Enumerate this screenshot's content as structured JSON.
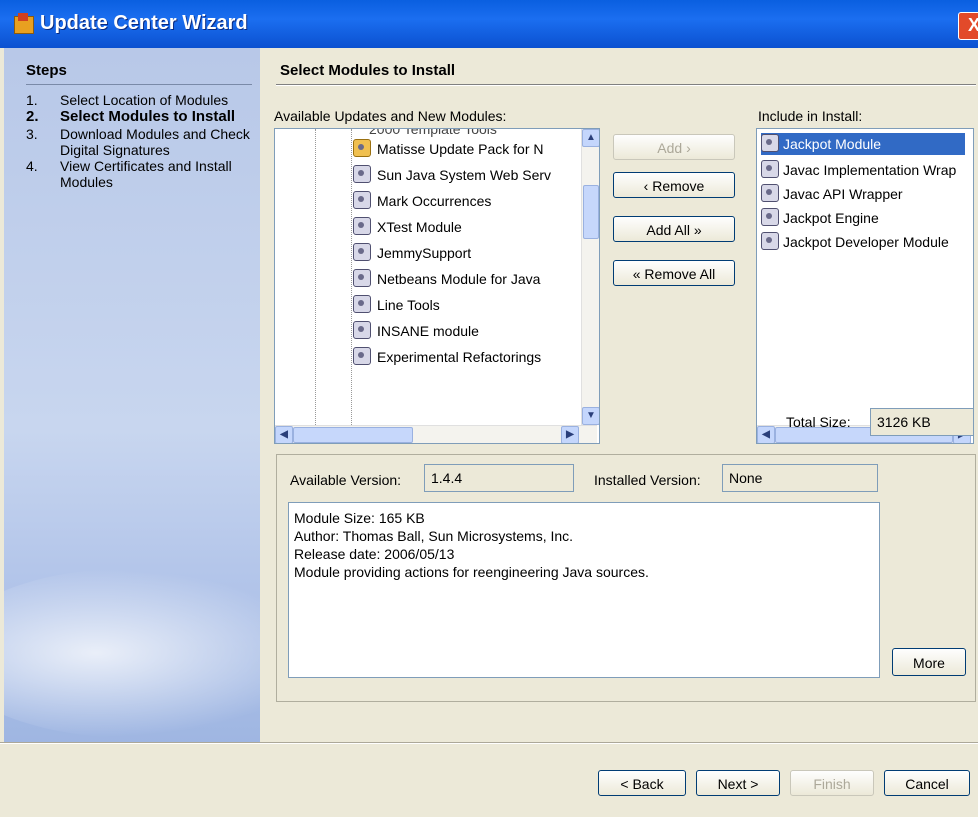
{
  "window": {
    "title": "Update Center Wizard",
    "close_label": "X"
  },
  "steps": {
    "heading": "Steps",
    "items": [
      {
        "num": "1.",
        "label": "Select Location of Modules"
      },
      {
        "num": "2.",
        "label": "Select Modules to Install"
      },
      {
        "num": "3.",
        "label": "Download Modules and Check Digital Signatures"
      },
      {
        "num": "4.",
        "label": "View Certificates and Install Modules"
      }
    ]
  },
  "main": {
    "heading": "Select Modules to Install"
  },
  "available": {
    "label": "Available Updates and New Modules:",
    "partial_top": "2000 Template Tools",
    "items": [
      "Matisse Update Pack for N",
      "Sun Java System Web Serv",
      "Mark Occurrences",
      "XTest Module",
      "JemmySupport",
      "Netbeans Module for Java",
      "Line Tools",
      "INSANE module",
      "Experimental Refactorings"
    ]
  },
  "buttons": {
    "add": "Add ›",
    "remove": "‹ Remove",
    "add_all": "Add All »",
    "remove_all": "« Remove All",
    "more": "More",
    "back": "< Back",
    "next": "Next >",
    "finish": "Finish",
    "cancel": "Cancel"
  },
  "include": {
    "label": "Include in Install:",
    "items": [
      "Jackpot Module",
      "Javac Implementation Wrap",
      "Javac API Wrapper",
      "Jackpot Engine",
      "Jackpot Developer Module"
    ],
    "selected_index": 0
  },
  "total_size": {
    "label": "Total Size:",
    "value": "3126 KB"
  },
  "details": {
    "available_version_label": "Available Version:",
    "available_version": "1.4.4",
    "installed_version_label": "Installed Version:",
    "installed_version": "None",
    "lines": [
      "Module Size: 165 KB",
      "Author: Thomas Ball, Sun Microsystems, Inc.",
      "Release date: 2006/05/13",
      "Module providing actions for reengineering Java sources."
    ]
  }
}
